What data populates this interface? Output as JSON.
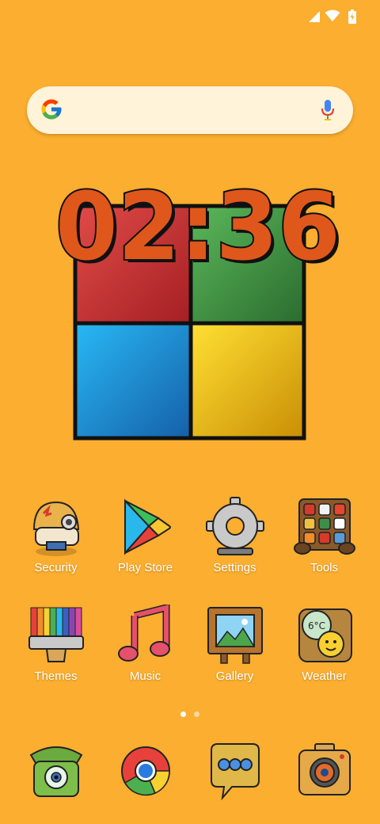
{
  "status_bar": {
    "icons": [
      "signal-icon",
      "wifi-icon",
      "battery-charging-icon"
    ]
  },
  "search": {
    "logo": "google-g-icon",
    "mic": "microphone-icon"
  },
  "clock": {
    "time": "02:36",
    "hours": "02",
    "minutes": "36"
  },
  "apps": [
    {
      "label": "Security",
      "icon": "security-miner-icon"
    },
    {
      "label": "Play Store",
      "icon": "play-store-icon"
    },
    {
      "label": "Settings",
      "icon": "settings-gear-icon"
    },
    {
      "label": "Tools",
      "icon": "tools-box-icon"
    },
    {
      "label": "Themes",
      "icon": "themes-brush-icon"
    },
    {
      "label": "Music",
      "icon": "music-note-icon"
    },
    {
      "label": "Gallery",
      "icon": "gallery-frame-icon"
    },
    {
      "label": "Weather",
      "icon": "weather-sun-icon"
    }
  ],
  "weather_badge": "6°C",
  "page_indicator": {
    "pages": 2,
    "current": 1
  },
  "dock": [
    {
      "icon": "phone-icon"
    },
    {
      "icon": "chrome-browser-icon"
    },
    {
      "icon": "messages-icon"
    },
    {
      "icon": "camera-icon"
    }
  ],
  "colors": {
    "background": "#FBAE2F",
    "clock_digits": "#E0571C",
    "label": "#FFFFFF"
  }
}
